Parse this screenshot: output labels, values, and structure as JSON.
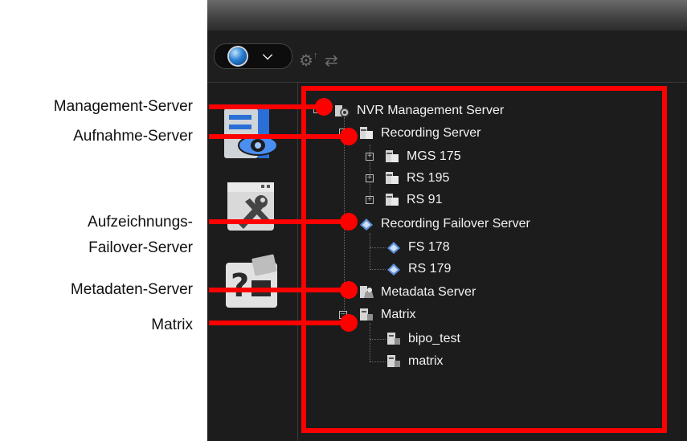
{
  "callouts": {
    "management": "Management-Server",
    "recording": "Aufnahme-Server",
    "failover_line1": "Aufzeichnungs-",
    "failover_line2": "Failover-Server",
    "metadata": "Metadaten-Server",
    "matrix": "Matrix"
  },
  "tree": {
    "root": "NVR Management Server",
    "recording": "Recording Server",
    "mgs175": "MGS 175",
    "rs195": "RS 195",
    "rs91": "RS 91",
    "failover": "Recording Failover Server",
    "fs178": "FS 178",
    "rs179": "RS 179",
    "metadata": "Metadata Server",
    "matrix": "Matrix",
    "bipo": "bipo_test",
    "matrix_child": "matrix"
  },
  "icons": {
    "globe": "globe-icon",
    "chevron": "chevron-down-icon",
    "settings_upload": "gear-upload-icon",
    "settings_sync": "gear-sync-icon",
    "server_monitor": "server-monitor-icon",
    "tools": "tools-icon",
    "help": "help-icon"
  },
  "colors": {
    "highlight": "#ff0000",
    "panel": "#1c1c1c",
    "text": "#f2f2f2"
  }
}
